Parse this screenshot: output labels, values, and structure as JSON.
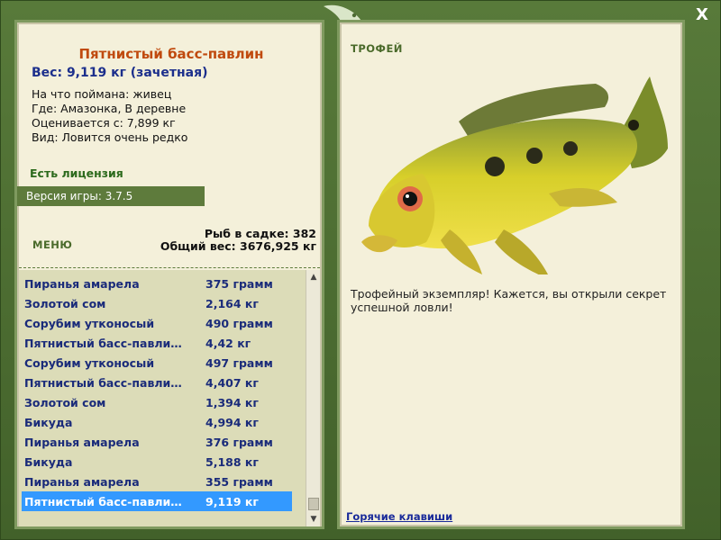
{
  "window": {
    "close_label": "X"
  },
  "fish": {
    "title": "Пятнистый басс-павлин",
    "weight_line": "Вес: 9,119 кг (зачетная)",
    "caught_on": "На что поймана: живец",
    "location": "Где: Амазонка, В деревне",
    "rated_from": "Оценивается с: 7,899 кг",
    "rarity": "Вид: Ловится очень редко"
  },
  "license": "Есть лицензия",
  "version": "Версия игры: 3.7.5",
  "menu_label": "МЕНЮ",
  "stats": {
    "fish_count": "Рыб в садке: 382",
    "total_weight": "Общий вес: 3676,925 кг"
  },
  "catch_list": [
    {
      "name": "Пиранья амарела",
      "weight": "375 грамм"
    },
    {
      "name": "Золотой сом",
      "weight": "2,164 кг"
    },
    {
      "name": "Сорубим утконосый",
      "weight": "490 грамм"
    },
    {
      "name": "Пятнистый басс-павли…",
      "weight": "4,42 кг"
    },
    {
      "name": "Сорубим утконосый",
      "weight": "497 грамм"
    },
    {
      "name": "Пятнистый басс-павли…",
      "weight": "4,407 кг"
    },
    {
      "name": "Золотой сом",
      "weight": "1,394 кг"
    },
    {
      "name": "Бикуда",
      "weight": "4,994 кг"
    },
    {
      "name": "Пиранья амарела",
      "weight": "376 грамм"
    },
    {
      "name": "Бикуда",
      "weight": "5,188 кг"
    },
    {
      "name": "Пиранья амарела",
      "weight": "355 грамм"
    },
    {
      "name": "Пятнистый басс-павли…",
      "weight": "9,119 кг"
    }
  ],
  "selected_index": 11,
  "trophy": {
    "label": "ТРОФЕЙ",
    "text": "Трофейный экземпляр! Кажется, вы открыли секрет успешной ловли!"
  },
  "hotkeys_label": "Горячие клавиши",
  "colors": {
    "frame": "#4d6b33",
    "panel": "#f4f0da",
    "title": "#c04a0e",
    "link": "#1a2b7a",
    "selection": "#3399ff"
  }
}
